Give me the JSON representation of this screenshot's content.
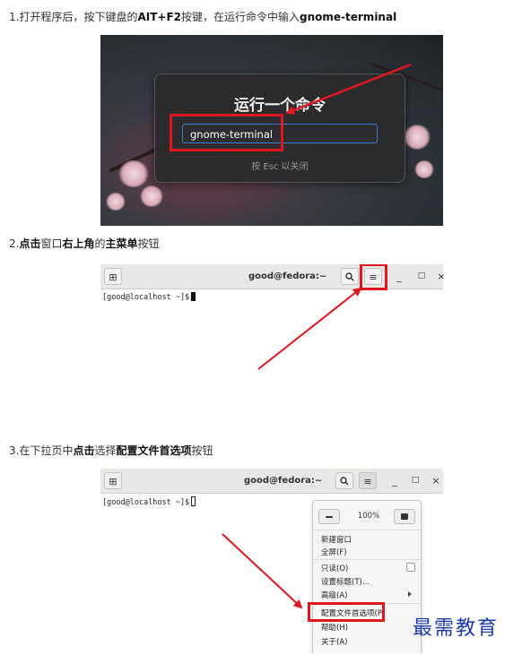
{
  "steps": {
    "step1": {
      "prefix": "1.打开程序后，按下键盘的",
      "key": "AIT+F2",
      "middle": "按键，在运行命令中输入",
      "cmd": "gnome-terminal"
    },
    "step2": {
      "prefix": "2.",
      "bold1": "点击",
      "mid1": "窗口",
      "bold2": "右上角",
      "mid2": "的",
      "bold3": "主菜单",
      "suffix": "按钮"
    },
    "step3": {
      "prefix": "3.在下拉页中",
      "bold1": "点击",
      "mid1": "选择",
      "bold2": "配置文件首选项",
      "suffix": "按钮"
    }
  },
  "run_dialog": {
    "title": "运行一个命令",
    "input_value": "gnome-terminal",
    "hint": "按 Esc 以关闭"
  },
  "terminal": {
    "title": "good@fedora:~",
    "prompt": "[good@localhost ~]$",
    "buttons": {
      "new_tab": "⊞",
      "search": "🔍",
      "menu": "≡",
      "minimize": "_",
      "maximize": "□",
      "close": "×"
    }
  },
  "menu": {
    "zoom": "100%",
    "items": {
      "new_window": "新建窗口",
      "fullscreen": "全屏(F)",
      "readonly": "只读(O)",
      "set_title": "设置标题(T)…",
      "advanced": "高级(A)",
      "preferences": "配置文件首选项(P)",
      "help": "帮助(H)",
      "about": "关于(A)"
    }
  },
  "watermark": "最需教育",
  "colors": {
    "highlight": "#e0161e",
    "accent": "#3a7bd5",
    "watermark": "#1c3aa5"
  }
}
